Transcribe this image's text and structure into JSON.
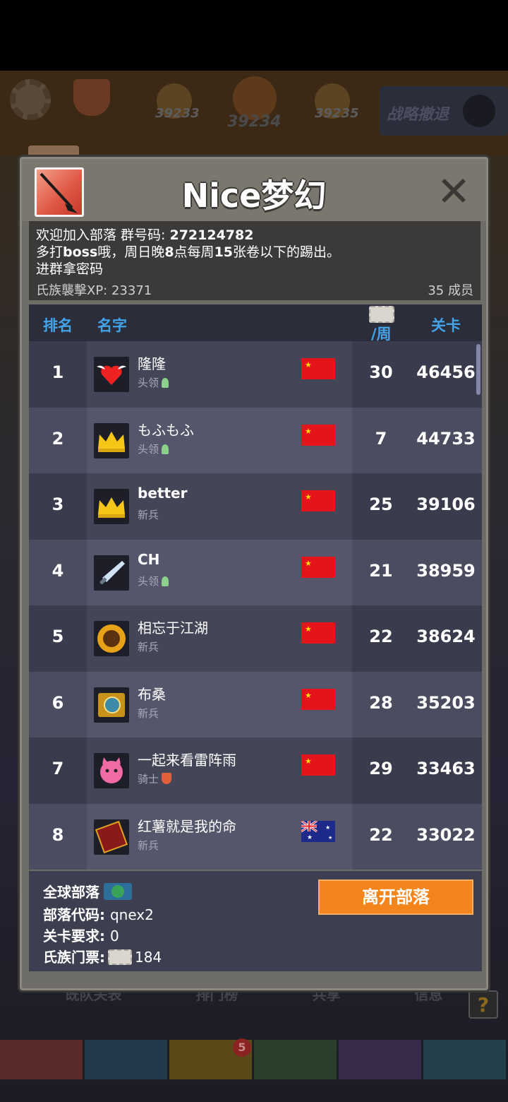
{
  "background": {
    "levels": [
      "39233",
      "39234",
      "39235"
    ],
    "retreat_label": "战略撤退",
    "under_tabs": [
      "既队关表",
      "排门榜",
      "共享",
      "信息"
    ],
    "help_label": "?",
    "notification_count": "5"
  },
  "clan": {
    "name": "Nice梦幻",
    "notice_line1_prefix": "欢迎加入部落 群号码: ",
    "notice_line1_number": "272124782",
    "notice_line2_a": "多打",
    "notice_line2_b": "boss",
    "notice_line2_c": "哦，周日晚",
    "notice_line2_d": "8",
    "notice_line2_e": "点每周",
    "notice_line2_f": "15",
    "notice_line2_g": "张卷以下的踢出。",
    "notice_line3": "进群拿密码",
    "xp_label": "氏族襲擊XP: 23371",
    "members_label": "35 成员"
  },
  "table": {
    "headers": {
      "rank": "排名",
      "name": "名字",
      "week": "/周",
      "level": "关卡"
    },
    "rows": [
      {
        "rank": "1",
        "name": "隆隆",
        "role": "头领",
        "flag": "CN",
        "week": "30",
        "level": "46456",
        "avatar": "winged-heart-icon",
        "name_bold": false,
        "badge": "medal"
      },
      {
        "rank": "2",
        "name": "もふもふ",
        "role": "头领",
        "flag": "CN",
        "week": "7",
        "level": "44733",
        "avatar": "crown-icon",
        "name_bold": false,
        "badge": "medal"
      },
      {
        "rank": "3",
        "name": "better",
        "role": "新兵",
        "flag": "CN",
        "week": "25",
        "level": "39106",
        "avatar": "crown-icon",
        "name_bold": true,
        "badge": ""
      },
      {
        "rank": "4",
        "name": "CH",
        "role": "头领",
        "flag": "CN",
        "week": "21",
        "level": "38959",
        "avatar": "sword-icon",
        "name_bold": true,
        "badge": "medal"
      },
      {
        "rank": "5",
        "name": "相忘于江湖",
        "role": "新兵",
        "flag": "CN",
        "week": "22",
        "level": "38624",
        "avatar": "sunflower-icon",
        "name_bold": false,
        "badge": ""
      },
      {
        "rank": "6",
        "name": "布桑",
        "role": "新兵",
        "flag": "CN",
        "week": "28",
        "level": "35203",
        "avatar": "golden-box-icon",
        "name_bold": false,
        "badge": ""
      },
      {
        "rank": "7",
        "name": "一起来看雷阵雨",
        "role": "骑士",
        "flag": "CN",
        "week": "29",
        "level": "33463",
        "avatar": "pink-monster-icon",
        "name_bold": false,
        "badge": "shield"
      },
      {
        "rank": "8",
        "name": "红薯就是我的命",
        "role": "新兵",
        "flag": "AU",
        "week": "22",
        "level": "33022",
        "avatar": "spellbook-icon",
        "name_bold": false,
        "badge": ""
      }
    ]
  },
  "footer": {
    "global_label": "全球部落",
    "code_label": "部落代码: ",
    "code_value": "qnex2",
    "req_label": "关卡要求: ",
    "req_value": "0",
    "ticket_label": "氏族门票:",
    "ticket_value": "184",
    "leave_label": "离开部落"
  },
  "colors": {
    "header_accent": "#43a3e6",
    "leave_button": "#f4851c",
    "panel": "#6e6c66"
  }
}
